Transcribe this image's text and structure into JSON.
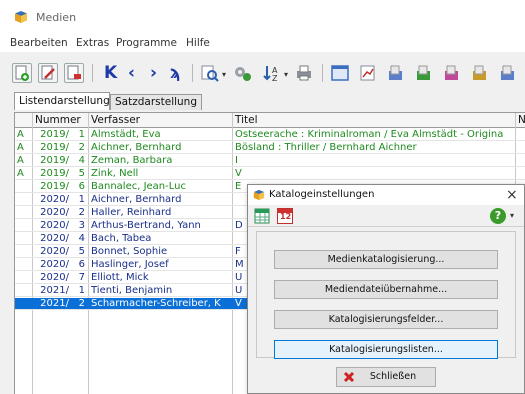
{
  "window": {
    "title": "Medien"
  },
  "menu": [
    "Bearbeiten",
    "Extras",
    "Programme",
    "Hilfe"
  ],
  "tabs": [
    "Listendarstellung",
    "Satzdarstellung"
  ],
  "columns": {
    "mark": "",
    "nummer": "Nummer",
    "verfasser": "Verfasser",
    "titel": "Titel",
    "extra": "N"
  },
  "rows": [
    {
      "mark": "A",
      "year": "2019/",
      "no": "1",
      "author": "Almstädt, Eva",
      "title": "Ostseerache : Kriminalroman / Eva Almstädt - Origina",
      "color": "#1e8a1e"
    },
    {
      "mark": "A",
      "year": "2019/",
      "no": "2",
      "author": "Aichner, Bernhard",
      "title": "Bösland : Thriller / Bernhard Aichner",
      "color": "#1e8a1e"
    },
    {
      "mark": "A",
      "year": "2019/",
      "no": "4",
      "author": "Zeman, Barbara",
      "title": "I",
      "color": "#1e8a1e"
    },
    {
      "mark": "A",
      "year": "2019/",
      "no": "5",
      "author": "Zink, Nell",
      "title": "V",
      "color": "#1e8a1e"
    },
    {
      "mark": "",
      "year": "2019/",
      "no": "6",
      "author": "Bannalec, Jean-Luc",
      "title": "E",
      "color": "#1e8a1e"
    },
    {
      "mark": "",
      "year": "2020/",
      "no": "1",
      "author": "Aichner, Bernhard",
      "title": "",
      "color": "#1a2f8a"
    },
    {
      "mark": "",
      "year": "2020/",
      "no": "2",
      "author": "Haller, Reinhard",
      "title": "",
      "color": "#1a2f8a"
    },
    {
      "mark": "",
      "year": "2020/",
      "no": "3",
      "author": "Arthus-Bertrand, Yann",
      "title": "D",
      "color": "#1a2f8a"
    },
    {
      "mark": "",
      "year": "2020/",
      "no": "4",
      "author": "Bach, Tabea",
      "title": "",
      "color": "#1a2f8a"
    },
    {
      "mark": "",
      "year": "2020/",
      "no": "5",
      "author": "Bonnet, Sophie",
      "title": "F",
      "color": "#1a2f8a"
    },
    {
      "mark": "",
      "year": "2020/",
      "no": "6",
      "author": "Haslinger, Josef",
      "title": "M",
      "color": "#1a2f8a"
    },
    {
      "mark": "",
      "year": "2020/",
      "no": "7",
      "author": "Elliott, Mick",
      "title": "U",
      "color": "#1a2f8a"
    },
    {
      "mark": "",
      "year": "2021/",
      "no": "1",
      "author": "Tienti, Benjamin",
      "title": "U",
      "color": "#1a2f8a"
    },
    {
      "mark": "",
      "year": "2021/",
      "no": "2",
      "author": "Scharmacher-Schreiber, K",
      "title": "V",
      "color": "#ffffff",
      "selected": true
    }
  ],
  "dialog": {
    "title": "Katalogeinstellungen",
    "close": "×",
    "buttons": [
      "Medienkatalogisierung...",
      "Mediendateiübernahme...",
      "Katalogisierungsfelder...",
      "Katalogisierungslisten..."
    ],
    "close_button": "Schließen",
    "help_glyph": "?",
    "calendar_text": "12"
  },
  "colors": {
    "selected_row": "#0a6fd6",
    "green_text": "#1e8a1e",
    "blue_text": "#1a2f8a"
  }
}
